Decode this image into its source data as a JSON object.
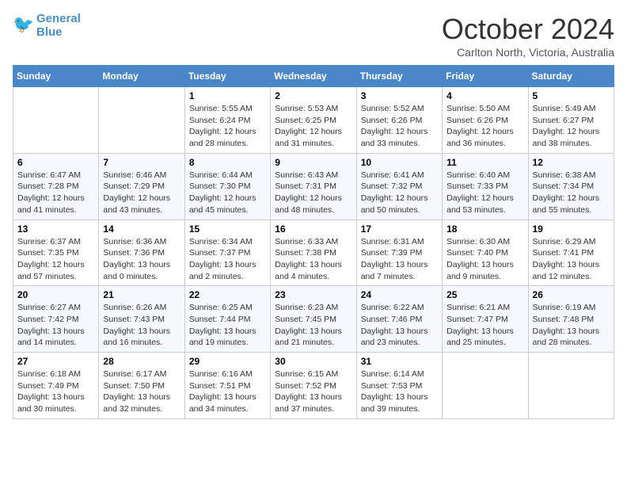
{
  "logo": {
    "line1": "General",
    "line2": "Blue"
  },
  "title": "October 2024",
  "subtitle": "Carlton North, Victoria, Australia",
  "days_of_week": [
    "Sunday",
    "Monday",
    "Tuesday",
    "Wednesday",
    "Thursday",
    "Friday",
    "Saturday"
  ],
  "weeks": [
    [
      {
        "day": "",
        "sunrise": "",
        "sunset": "",
        "daylight": ""
      },
      {
        "day": "",
        "sunrise": "",
        "sunset": "",
        "daylight": ""
      },
      {
        "day": "1",
        "sunrise": "Sunrise: 5:55 AM",
        "sunset": "Sunset: 6:24 PM",
        "daylight": "Daylight: 12 hours and 28 minutes."
      },
      {
        "day": "2",
        "sunrise": "Sunrise: 5:53 AM",
        "sunset": "Sunset: 6:25 PM",
        "daylight": "Daylight: 12 hours and 31 minutes."
      },
      {
        "day": "3",
        "sunrise": "Sunrise: 5:52 AM",
        "sunset": "Sunset: 6:26 PM",
        "daylight": "Daylight: 12 hours and 33 minutes."
      },
      {
        "day": "4",
        "sunrise": "Sunrise: 5:50 AM",
        "sunset": "Sunset: 6:26 PM",
        "daylight": "Daylight: 12 hours and 36 minutes."
      },
      {
        "day": "5",
        "sunrise": "Sunrise: 5:49 AM",
        "sunset": "Sunset: 6:27 PM",
        "daylight": "Daylight: 12 hours and 38 minutes."
      }
    ],
    [
      {
        "day": "6",
        "sunrise": "Sunrise: 6:47 AM",
        "sunset": "Sunset: 7:28 PM",
        "daylight": "Daylight: 12 hours and 41 minutes."
      },
      {
        "day": "7",
        "sunrise": "Sunrise: 6:46 AM",
        "sunset": "Sunset: 7:29 PM",
        "daylight": "Daylight: 12 hours and 43 minutes."
      },
      {
        "day": "8",
        "sunrise": "Sunrise: 6:44 AM",
        "sunset": "Sunset: 7:30 PM",
        "daylight": "Daylight: 12 hours and 45 minutes."
      },
      {
        "day": "9",
        "sunrise": "Sunrise: 6:43 AM",
        "sunset": "Sunset: 7:31 PM",
        "daylight": "Daylight: 12 hours and 48 minutes."
      },
      {
        "day": "10",
        "sunrise": "Sunrise: 6:41 AM",
        "sunset": "Sunset: 7:32 PM",
        "daylight": "Daylight: 12 hours and 50 minutes."
      },
      {
        "day": "11",
        "sunrise": "Sunrise: 6:40 AM",
        "sunset": "Sunset: 7:33 PM",
        "daylight": "Daylight: 12 hours and 53 minutes."
      },
      {
        "day": "12",
        "sunrise": "Sunrise: 6:38 AM",
        "sunset": "Sunset: 7:34 PM",
        "daylight": "Daylight: 12 hours and 55 minutes."
      }
    ],
    [
      {
        "day": "13",
        "sunrise": "Sunrise: 6:37 AM",
        "sunset": "Sunset: 7:35 PM",
        "daylight": "Daylight: 12 hours and 57 minutes."
      },
      {
        "day": "14",
        "sunrise": "Sunrise: 6:36 AM",
        "sunset": "Sunset: 7:36 PM",
        "daylight": "Daylight: 13 hours and 0 minutes."
      },
      {
        "day": "15",
        "sunrise": "Sunrise: 6:34 AM",
        "sunset": "Sunset: 7:37 PM",
        "daylight": "Daylight: 13 hours and 2 minutes."
      },
      {
        "day": "16",
        "sunrise": "Sunrise: 6:33 AM",
        "sunset": "Sunset: 7:38 PM",
        "daylight": "Daylight: 13 hours and 4 minutes."
      },
      {
        "day": "17",
        "sunrise": "Sunrise: 6:31 AM",
        "sunset": "Sunset: 7:39 PM",
        "daylight": "Daylight: 13 hours and 7 minutes."
      },
      {
        "day": "18",
        "sunrise": "Sunrise: 6:30 AM",
        "sunset": "Sunset: 7:40 PM",
        "daylight": "Daylight: 13 hours and 9 minutes."
      },
      {
        "day": "19",
        "sunrise": "Sunrise: 6:29 AM",
        "sunset": "Sunset: 7:41 PM",
        "daylight": "Daylight: 13 hours and 12 minutes."
      }
    ],
    [
      {
        "day": "20",
        "sunrise": "Sunrise: 6:27 AM",
        "sunset": "Sunset: 7:42 PM",
        "daylight": "Daylight: 13 hours and 14 minutes."
      },
      {
        "day": "21",
        "sunrise": "Sunrise: 6:26 AM",
        "sunset": "Sunset: 7:43 PM",
        "daylight": "Daylight: 13 hours and 16 minutes."
      },
      {
        "day": "22",
        "sunrise": "Sunrise: 6:25 AM",
        "sunset": "Sunset: 7:44 PM",
        "daylight": "Daylight: 13 hours and 19 minutes."
      },
      {
        "day": "23",
        "sunrise": "Sunrise: 6:23 AM",
        "sunset": "Sunset: 7:45 PM",
        "daylight": "Daylight: 13 hours and 21 minutes."
      },
      {
        "day": "24",
        "sunrise": "Sunrise: 6:22 AM",
        "sunset": "Sunset: 7:46 PM",
        "daylight": "Daylight: 13 hours and 23 minutes."
      },
      {
        "day": "25",
        "sunrise": "Sunrise: 6:21 AM",
        "sunset": "Sunset: 7:47 PM",
        "daylight": "Daylight: 13 hours and 25 minutes."
      },
      {
        "day": "26",
        "sunrise": "Sunrise: 6:19 AM",
        "sunset": "Sunset: 7:48 PM",
        "daylight": "Daylight: 13 hours and 28 minutes."
      }
    ],
    [
      {
        "day": "27",
        "sunrise": "Sunrise: 6:18 AM",
        "sunset": "Sunset: 7:49 PM",
        "daylight": "Daylight: 13 hours and 30 minutes."
      },
      {
        "day": "28",
        "sunrise": "Sunrise: 6:17 AM",
        "sunset": "Sunset: 7:50 PM",
        "daylight": "Daylight: 13 hours and 32 minutes."
      },
      {
        "day": "29",
        "sunrise": "Sunrise: 6:16 AM",
        "sunset": "Sunset: 7:51 PM",
        "daylight": "Daylight: 13 hours and 34 minutes."
      },
      {
        "day": "30",
        "sunrise": "Sunrise: 6:15 AM",
        "sunset": "Sunset: 7:52 PM",
        "daylight": "Daylight: 13 hours and 37 minutes."
      },
      {
        "day": "31",
        "sunrise": "Sunrise: 6:14 AM",
        "sunset": "Sunset: 7:53 PM",
        "daylight": "Daylight: 13 hours and 39 minutes."
      },
      {
        "day": "",
        "sunrise": "",
        "sunset": "",
        "daylight": ""
      },
      {
        "day": "",
        "sunrise": "",
        "sunset": "",
        "daylight": ""
      }
    ]
  ]
}
